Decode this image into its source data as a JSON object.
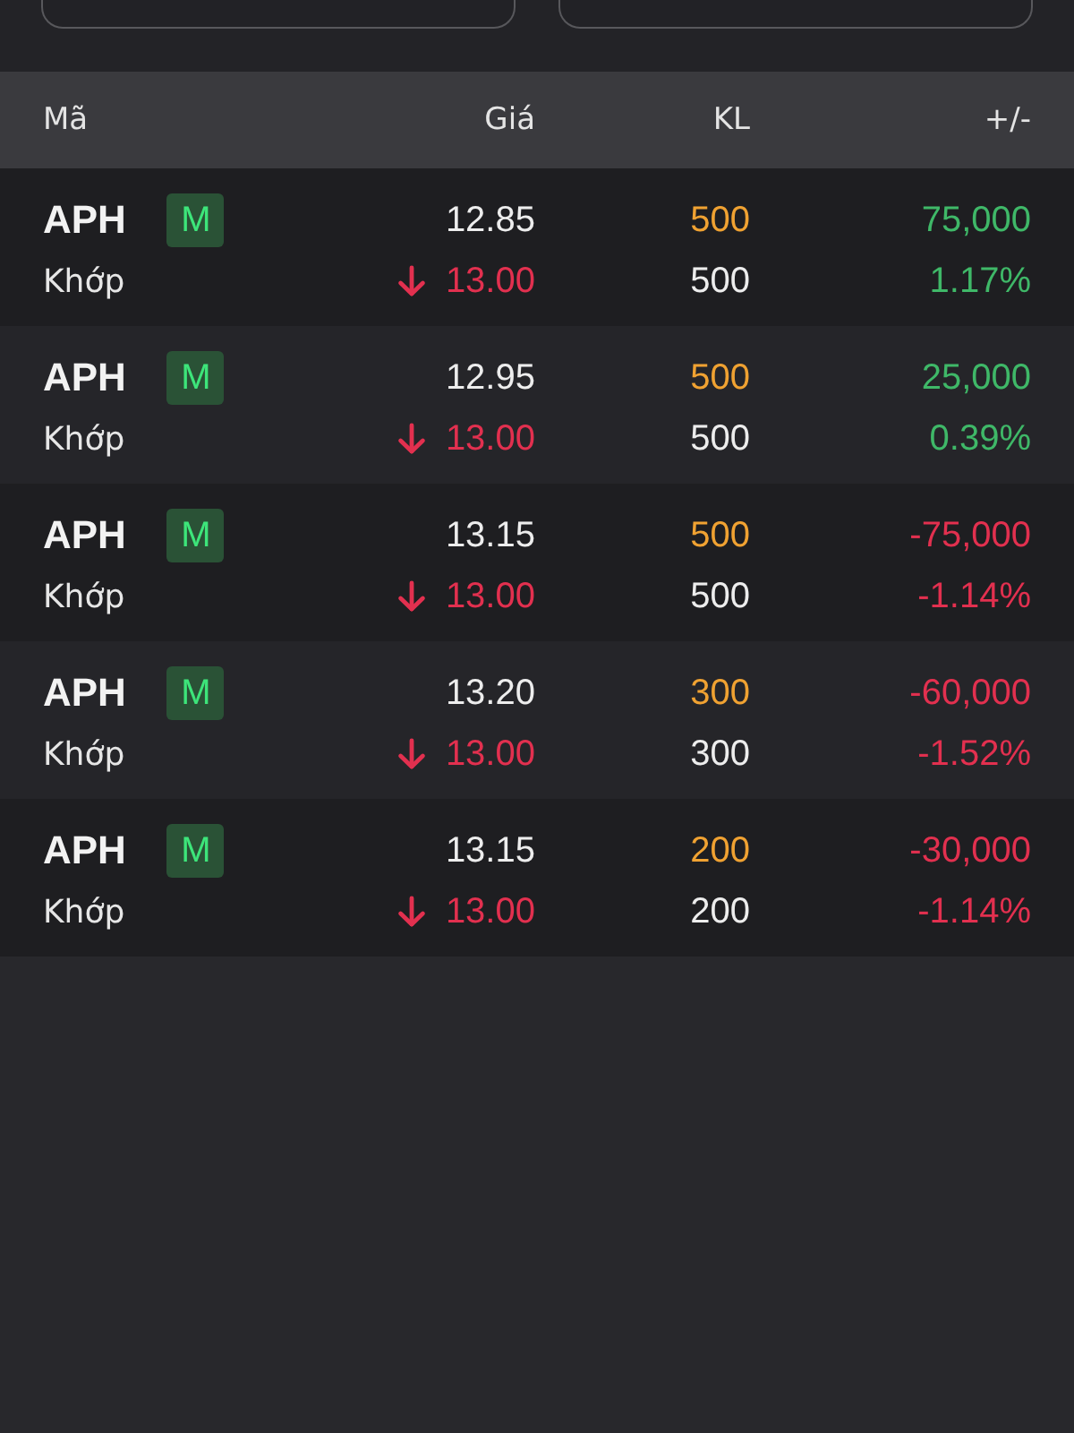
{
  "top_buttons": [
    {
      "kind": "outline"
    },
    {
      "kind": "outline"
    }
  ],
  "columns": [
    "Mã",
    "Giá",
    "KL",
    "+/-"
  ],
  "rows": [
    {
      "symbol": "APH",
      "badge": "M",
      "status": "Khớp",
      "price": "12.85",
      "match_price": "13.00",
      "match_falling": true,
      "volume": "500",
      "match_volume": "500",
      "change": "75,000",
      "change_pct": "1.17%",
      "gain": true
    },
    {
      "symbol": "APH",
      "badge": "M",
      "status": "Khớp",
      "price": "12.95",
      "match_price": "13.00",
      "match_falling": true,
      "volume": "500",
      "match_volume": "500",
      "change": "25,000",
      "change_pct": "0.39%",
      "gain": true
    },
    {
      "symbol": "APH",
      "badge": "M",
      "status": "Khớp",
      "price": "13.15",
      "match_price": "13.00",
      "match_falling": true,
      "volume": "500",
      "match_volume": "500",
      "change": "-75,000",
      "change_pct": "-1.14%",
      "gain": false
    },
    {
      "symbol": "APH",
      "badge": "M",
      "status": "Khớp",
      "price": "13.20",
      "match_price": "13.00",
      "match_falling": true,
      "volume": "300",
      "match_volume": "300",
      "change": "-60,000",
      "change_pct": "-1.52%",
      "gain": false
    },
    {
      "symbol": "APH",
      "badge": "M",
      "status": "Khớp",
      "price": "13.15",
      "match_price": "13.00",
      "match_falling": true,
      "volume": "200",
      "match_volume": "200",
      "change": "-30,000",
      "change_pct": "-1.14%",
      "gain": false
    }
  ]
}
